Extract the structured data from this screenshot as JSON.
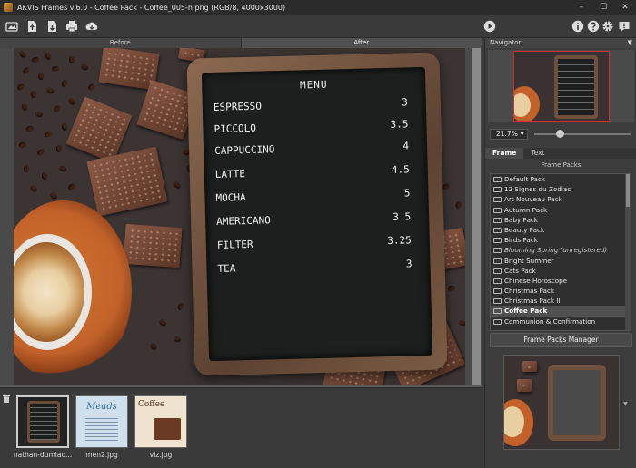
{
  "window": {
    "title": "AKVIS Frames v.6.0 - Coffee Pack - Coffee_005-h.png (RGB/8, 4000x3000)",
    "minimize": "–",
    "maximize": "☐",
    "close": "✕"
  },
  "toolbar": {
    "left_icons": [
      "open-image-icon",
      "import-icon",
      "export-icon",
      "print-icon",
      "cloud-download-icon"
    ],
    "run_icon": "play-icon",
    "right_icons": [
      "info-icon",
      "help-icon",
      "settings-icon",
      "notification-icon"
    ]
  },
  "view_tabs": {
    "before": "Before",
    "after": "After",
    "active": "After"
  },
  "menu_board": {
    "title": "MENU",
    "items": [
      {
        "name": "ESPRESSO",
        "price": "3"
      },
      {
        "name": "PICCOLO",
        "price": "3.5"
      },
      {
        "name": "CAPPUCCINO",
        "price": "4"
      },
      {
        "name": "LATTE",
        "price": "4.5"
      },
      {
        "name": "MOCHA",
        "price": "5"
      },
      {
        "name": "AMERICANO",
        "price": "3.5"
      },
      {
        "name": "FILTER",
        "price": "3.25"
      },
      {
        "name": "TEA",
        "price": "3"
      }
    ]
  },
  "thumbnails": [
    {
      "label": "nathan-dumlao...",
      "selected": true
    },
    {
      "label": "men2.jpg",
      "selected": false
    },
    {
      "label": "viz.jpg",
      "selected": false
    }
  ],
  "thumb_texts": {
    "meads": "Meads",
    "coffee": "Coffee"
  },
  "navigator": {
    "title": "Navigator",
    "zoom": "21.7%"
  },
  "frame_tabs": {
    "frame": "Frame",
    "text": "Text",
    "active": "Frame"
  },
  "frame_packs": {
    "heading": "Frame Packs",
    "items": [
      {
        "label": "Default Pack"
      },
      {
        "label": "12 Signes du Zodiac"
      },
      {
        "label": "Art Nouveau Pack"
      },
      {
        "label": "Autumn Pack"
      },
      {
        "label": "Baby Pack"
      },
      {
        "label": "Beauty Pack"
      },
      {
        "label": "Birds Pack"
      },
      {
        "label": "Blooming Spring (unregistered)",
        "unregistered": true
      },
      {
        "label": "Bright Summer"
      },
      {
        "label": "Cats Pack"
      },
      {
        "label": "Chinese Horoscope"
      },
      {
        "label": "Christmas Pack"
      },
      {
        "label": "Christmas Pack II"
      },
      {
        "label": "Coffee Pack",
        "selected": true
      },
      {
        "label": "Communion & Confirmation"
      }
    ],
    "manager_button": "Frame Packs Manager"
  },
  "colors": {
    "panel_bg": "#3c3c3c",
    "selection": "#505050",
    "navigator_border": "#d03030",
    "frame_wood": "#6e503c",
    "board": "#1c1f1e"
  }
}
